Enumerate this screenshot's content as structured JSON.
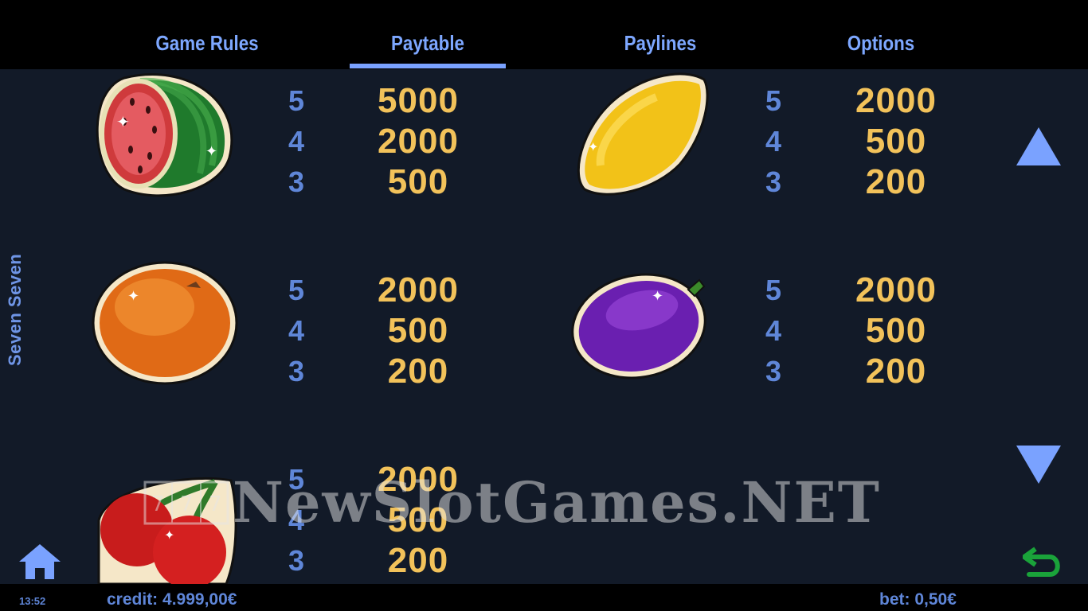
{
  "tabs": [
    {
      "label": "Game Rules"
    },
    {
      "label": "Paytable"
    },
    {
      "label": "Paylines"
    },
    {
      "label": "Options"
    }
  ],
  "side_title": "Seven Seven",
  "paytable": [
    {
      "symbol": "watermelon-icon",
      "counts": [
        "5",
        "4",
        "3"
      ],
      "payouts": [
        "5000",
        "2000",
        "500"
      ]
    },
    {
      "symbol": "lemon-icon",
      "counts": [
        "5",
        "4",
        "3"
      ],
      "payouts": [
        "2000",
        "500",
        "200"
      ]
    },
    {
      "symbol": "orange-icon",
      "counts": [
        "5",
        "4",
        "3"
      ],
      "payouts": [
        "2000",
        "500",
        "200"
      ]
    },
    {
      "symbol": "plum-icon",
      "counts": [
        "5",
        "4",
        "3"
      ],
      "payouts": [
        "2000",
        "500",
        "200"
      ]
    },
    {
      "symbol": "cherries-icon",
      "counts": [
        "5",
        "4",
        "3"
      ],
      "payouts": [
        "2000",
        "500",
        "200"
      ]
    }
  ],
  "status": {
    "time": "13:52",
    "credit": "credit: 4.999,00€",
    "bet": "bet: 0,50€"
  },
  "watermark": "NewSlotGames.NET",
  "colors": {
    "background": "#121a28",
    "accent": "#7aa2ff",
    "payout": "#f2c25a",
    "count": "#5f86d8",
    "back_arrow": "#1aa33a"
  }
}
